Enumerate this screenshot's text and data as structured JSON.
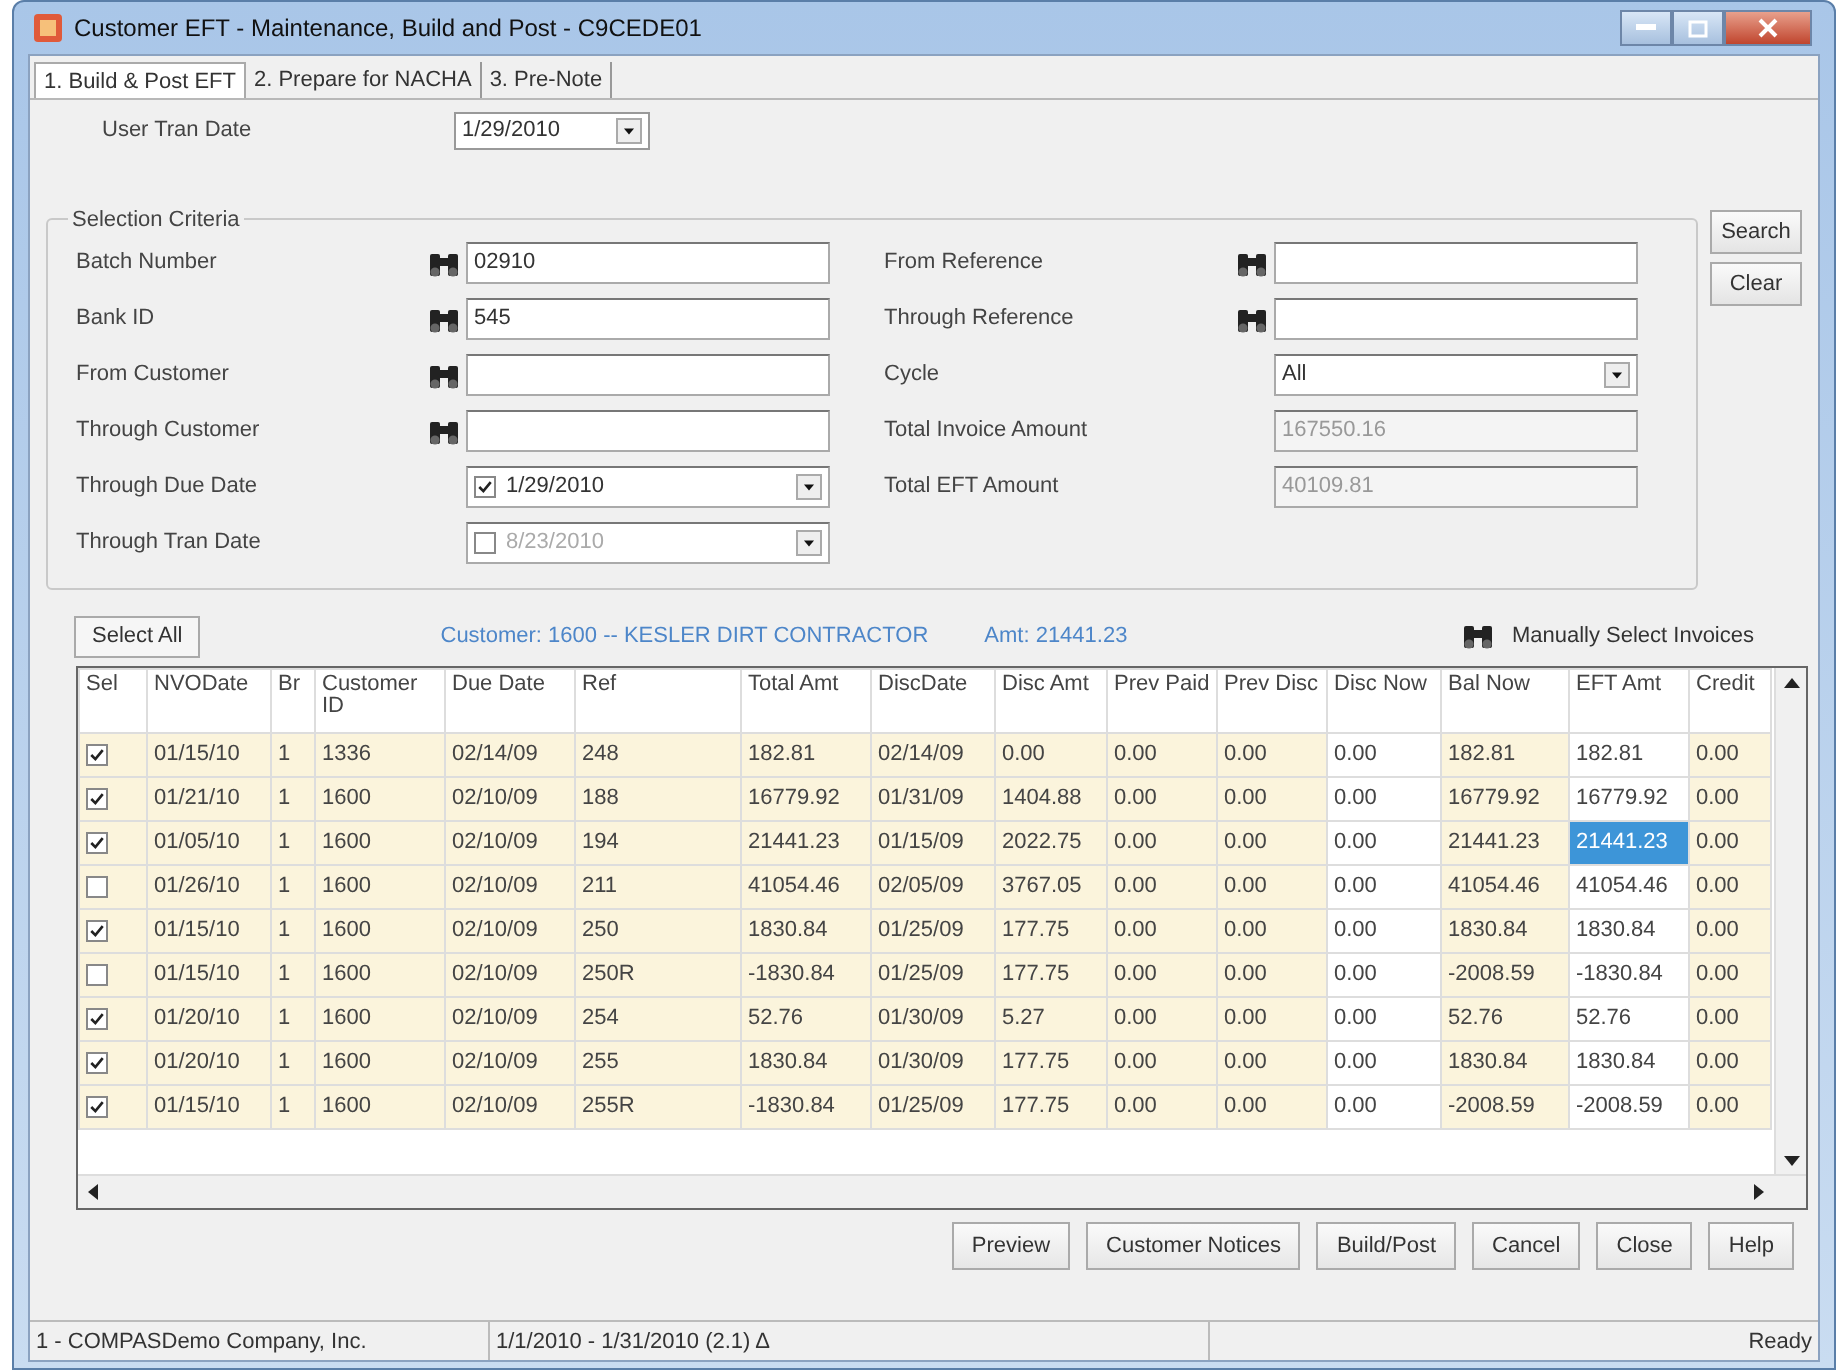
{
  "window": {
    "title": "Customer EFT - Maintenance, Build and Post  - C9CEDE01"
  },
  "tabs": [
    {
      "label": "1. Build & Post EFT",
      "selected": true
    },
    {
      "label": "2. Prepare for NACHA",
      "selected": false
    },
    {
      "label": "3. Pre-Note",
      "selected": false
    }
  ],
  "user_tran_date": {
    "label": "User Tran Date",
    "value": "1/29/2010"
  },
  "selection_criteria": {
    "title": "Selection Criteria",
    "left_fields": [
      {
        "label": "Batch Number",
        "kind": "lookup",
        "value": "02910"
      },
      {
        "label": "Bank ID",
        "kind": "lookup",
        "value": "545"
      },
      {
        "label": "From Customer",
        "kind": "lookup"
      },
      {
        "label": "Through Customer",
        "kind": "lookup"
      },
      {
        "label": "Through Due Date",
        "kind": "date",
        "value": "1/29/2010",
        "checked": true
      },
      {
        "label": "Through Tran Date",
        "kind": "date",
        "value": "8/23/2010",
        "checked": false
      }
    ],
    "right_fields": [
      {
        "label": "From Reference",
        "kind": "lookup"
      },
      {
        "label": "Through Reference",
        "kind": "lookup"
      },
      {
        "label": "Cycle",
        "kind": "select",
        "value": "All"
      },
      {
        "label": "Total Invoice Amount",
        "kind": "readonly",
        "value": "167550.16"
      },
      {
        "label": "Total EFT Amount",
        "kind": "readonly",
        "value": "40109.81"
      }
    ]
  },
  "side_buttons": [
    "Search",
    "Clear"
  ],
  "select_all": "Select All",
  "customer_info": "Customer: 1600 -- KESLER DIRT CONTRACTOR",
  "amount_info": "Amt: 21441.23",
  "manual_select": "Manually Select Invoices",
  "table": {
    "select_column": "Sel",
    "columns": [
      "NVODate",
      "Br",
      "Customer ID",
      "Due Date",
      "Ref",
      "Total Amt",
      "DiscDate",
      "Disc Amt",
      "Prev Paid",
      "Prev Disc",
      "Disc Now",
      "Bal Now",
      "EFT Amt",
      "Credit"
    ],
    "rows": [
      {
        "checked": true,
        "focused": false,
        "cells": [
          "01/15/10",
          "1",
          "1336",
          "02/14/09",
          "248",
          "182.81",
          "02/14/09",
          "0.00",
          "0.00",
          "0.00",
          "0.00",
          "182.81",
          "182.81",
          "0.00"
        ]
      },
      {
        "checked": true,
        "focused": false,
        "cells": [
          "01/21/10",
          "1",
          "1600",
          "02/10/09",
          "188",
          "16779.92",
          "01/31/09",
          "1404.88",
          "0.00",
          "0.00",
          "0.00",
          "16779.92",
          "16779.92",
          "0.00"
        ]
      },
      {
        "checked": true,
        "focused": true,
        "cells": [
          "01/05/10",
          "1",
          "1600",
          "02/10/09",
          "194",
          "21441.23",
          "01/15/09",
          "2022.75",
          "0.00",
          "0.00",
          "0.00",
          "21441.23",
          "21441.23",
          "0.00"
        ]
      },
      {
        "checked": false,
        "focused": false,
        "cells": [
          "01/26/10",
          "1",
          "1600",
          "02/10/09",
          "211",
          "41054.46",
          "02/05/09",
          "3767.05",
          "0.00",
          "0.00",
          "0.00",
          "41054.46",
          "41054.46",
          "0.00"
        ]
      },
      {
        "checked": true,
        "focused": false,
        "cells": [
          "01/15/10",
          "1",
          "1600",
          "02/10/09",
          "250",
          "1830.84",
          "01/25/09",
          "177.75",
          "0.00",
          "0.00",
          "0.00",
          "1830.84",
          "1830.84",
          "0.00"
        ]
      },
      {
        "checked": false,
        "focused": false,
        "cells": [
          "01/15/10",
          "1",
          "1600",
          "02/10/09",
          "250R",
          "-1830.84",
          "01/25/09",
          "177.75",
          "0.00",
          "0.00",
          "0.00",
          "-2008.59",
          "-1830.84",
          "0.00"
        ]
      },
      {
        "checked": true,
        "focused": false,
        "cells": [
          "01/20/10",
          "1",
          "1600",
          "02/10/09",
          "254",
          "52.76",
          "01/30/09",
          "5.27",
          "0.00",
          "0.00",
          "0.00",
          "52.76",
          "52.76",
          "0.00"
        ]
      },
      {
        "checked": true,
        "focused": false,
        "cells": [
          "01/20/10",
          "1",
          "1600",
          "02/10/09",
          "255",
          "1830.84",
          "01/30/09",
          "177.75",
          "0.00",
          "0.00",
          "0.00",
          "1830.84",
          "1830.84",
          "0.00"
        ]
      },
      {
        "checked": true,
        "focused": false,
        "cells": [
          "01/15/10",
          "1",
          "1600",
          "02/10/09",
          "255R",
          "-1830.84",
          "01/25/09",
          "177.75",
          "0.00",
          "0.00",
          "0.00",
          "-2008.59",
          "-2008.59",
          "0.00"
        ]
      }
    ]
  },
  "buttons": [
    "Preview",
    "Customer Notices",
    "Build/Post",
    "Cancel",
    "Close",
    "Help"
  ],
  "status_bar": [
    "1 - COMPASDemo Company, Inc.",
    "1/1/2010 - 1/31/2010 (2.1)  Δ",
    "Ready"
  ]
}
